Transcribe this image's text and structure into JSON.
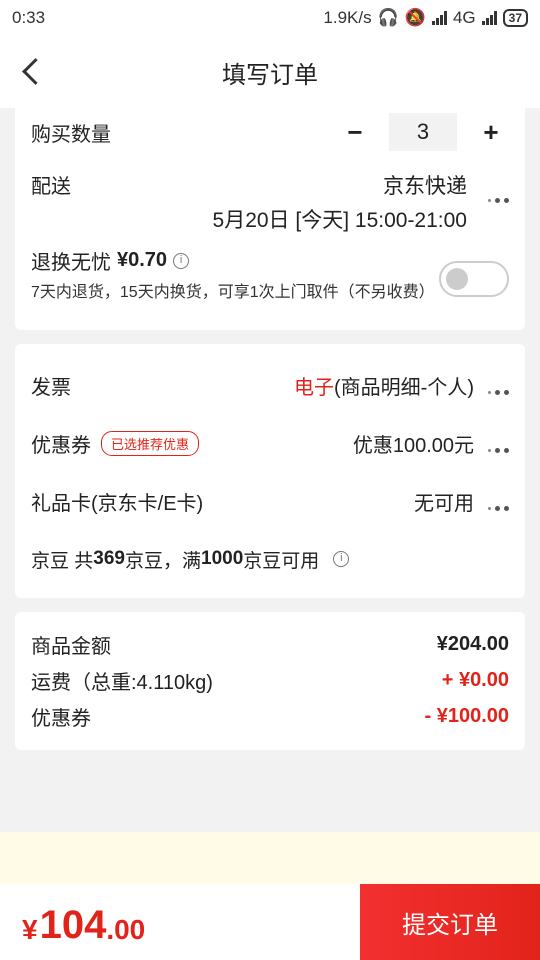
{
  "status": {
    "time": "0:33",
    "speed": "1.9K/s",
    "network": "4G",
    "battery": "37"
  },
  "nav": {
    "title": "填写订单"
  },
  "quantity": {
    "label": "购买数量",
    "minus": "−",
    "value": "3",
    "plus": "+"
  },
  "shipping": {
    "label": "配送",
    "carrier": "京东快递",
    "slot": "5月20日 [今天] 15:00-21:00"
  },
  "insurance": {
    "title": "退换无忧",
    "price": "¥0.70",
    "desc": "7天内退货，15天内换货，可享1次上门取件（不另收费）",
    "enabled": false
  },
  "invoice": {
    "label": "发票",
    "type": "电子",
    "detail": "(商品明细-个人)"
  },
  "coupon": {
    "label": "优惠券",
    "badge": "已选推荐优惠",
    "value": "优惠100.00元"
  },
  "giftcard": {
    "label": "礼品卡(京东卡/E卡)",
    "value": "无可用"
  },
  "jingdou": {
    "prefix": "京豆 共",
    "count": "369",
    "mid": "京豆，满",
    "threshold": "1000",
    "suffix": "京豆可用"
  },
  "summary": {
    "goods_label": "商品金额",
    "goods_amount": "¥204.00",
    "freight_label": "运费（总重:4.110kg)",
    "freight_amount": "+ ¥0.00",
    "coupon_label": "优惠券",
    "coupon_amount": "- ¥100.00"
  },
  "footer": {
    "currency": "¥",
    "total_int": "104",
    "total_dec": ".00",
    "submit": "提交订单"
  },
  "colors": {
    "accent": "#e2231a"
  }
}
